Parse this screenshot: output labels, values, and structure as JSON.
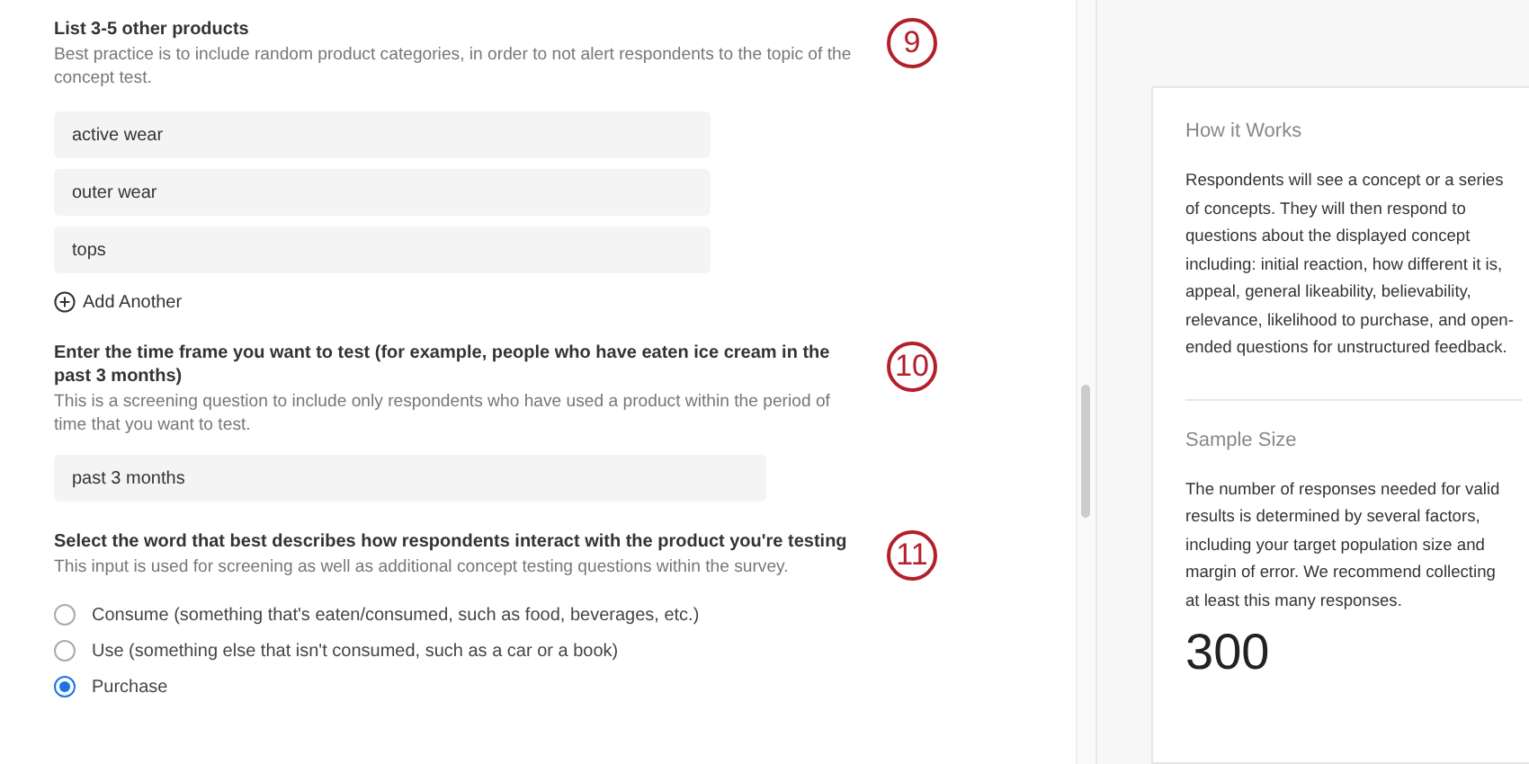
{
  "questions": [
    {
      "kind": "text-list",
      "title": "List 3-5 other products",
      "hint": "Best practice is to include random product categories, in order to not alert respondents to the topic of the concept test.",
      "callout": "9",
      "values": [
        "active wear",
        "outer wear",
        "tops"
      ],
      "add_label": "Add Another"
    },
    {
      "kind": "text",
      "title": "Enter the time frame you want to test (for example, people who have eaten ice cream in the past 3 months)",
      "hint": "This is a screening question to include only respondents who have used a product within the period of time that you want to test.",
      "callout": "10",
      "value": "past 3 months"
    },
    {
      "kind": "radio",
      "title": "Select the word that best describes how respondents interact with the product you're testing",
      "hint": "This input is used for screening as well as additional concept testing questions within the survey.",
      "callout": "11",
      "options": [
        {
          "label": "Consume (something that's eaten/consumed, such as food, beverages, etc.)",
          "selected": false
        },
        {
          "label": "Use (something else that isn't consumed, such as a car or a book)",
          "selected": false
        },
        {
          "label": "Purchase",
          "selected": true
        }
      ]
    }
  ],
  "side_panel": {
    "sections": [
      {
        "heading": "How it Works",
        "body": "Respondents will see a concept or a series of concepts. They will then respond to questions about the displayed concept including: initial reaction, how different it is, appeal, general likeability, believability, relevance, likelihood to purchase, and open-ended questions for unstructured feedback."
      },
      {
        "heading": "Sample Size",
        "body": "The number of responses needed for valid results is determined by several factors, including your target population size and margin of error. We recommend collecting at least this many responses.",
        "figure": "300"
      }
    ]
  }
}
